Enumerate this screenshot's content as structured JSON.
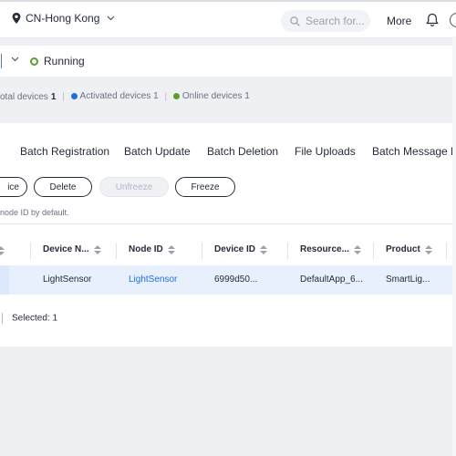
{
  "header": {
    "region": "CN-Hong Kong",
    "search_placeholder": "Search for...",
    "more": "More"
  },
  "status": {
    "running": "Running"
  },
  "summary": {
    "total_label": "otal devices",
    "total_value": "1",
    "activated_label": "Activated devices",
    "activated_value": "1",
    "online_label": "Online devices",
    "online_value": "1"
  },
  "tabs": [
    "Batch Registration",
    "Batch Update",
    "Batch Deletion",
    "File Uploads",
    "Batch Message De"
  ],
  "actions": {
    "cut": "ice",
    "delete": "Delete",
    "unfreeze": "Unfreeze",
    "freeze": "Freeze"
  },
  "hint": "node ID by default.",
  "table": {
    "columns": [
      "Device N...",
      "Node ID",
      "Device ID",
      "Resource...",
      "Product"
    ],
    "row": {
      "device_name": "LightSensor",
      "node_id": "LightSensor",
      "device_id": "6999d50...",
      "resource": "DefaultApp_6...",
      "product": "SmartLig..."
    }
  },
  "footer": {
    "selected": "Selected: 1"
  },
  "colors": {
    "accent": "#1d6fe1",
    "running": "#5aa02c",
    "activated": "#1d6fe1",
    "online": "#5aa02c"
  }
}
